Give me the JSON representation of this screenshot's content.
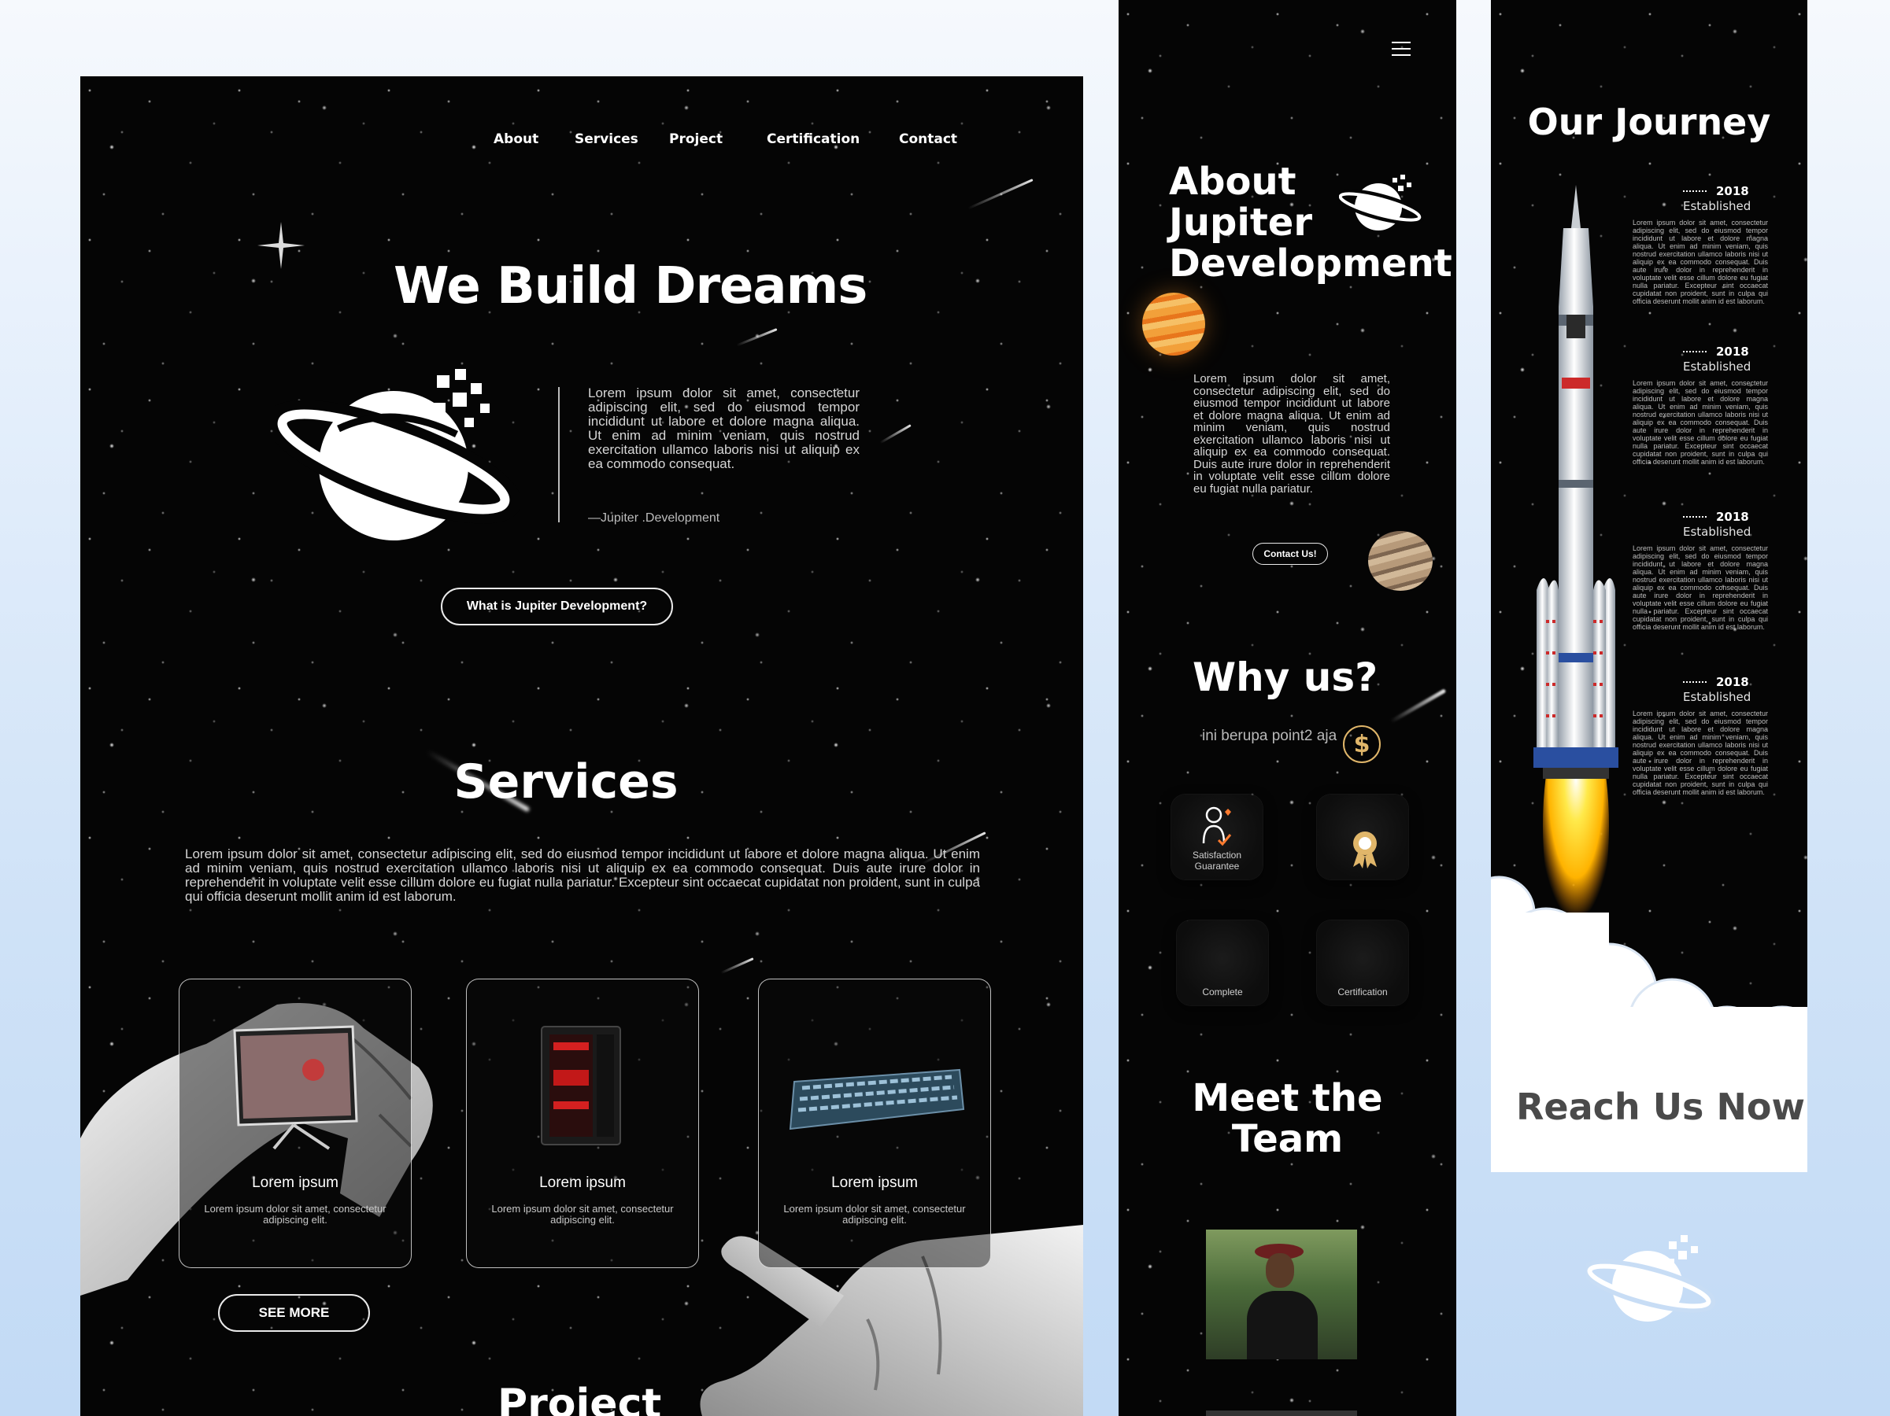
{
  "nav": {
    "links": [
      "About",
      "Services",
      "Project",
      "Certification",
      "Contact"
    ]
  },
  "hero": {
    "title": "We Build Dreams",
    "quote": "Lorem ipsum dolor sit amet, consectetur adipiscing elit, sed do eiusmod tempor incididunt ut labore et dolore magna aliqua. Ut enim ad minim veniam, quis nostrud exercitation ullamco laboris nisi ut aliquip ex ea commodo consequat.",
    "signature": "—Jupiter .Development",
    "cta_label": "What is Jupiter Development?"
  },
  "services": {
    "title": "Services",
    "description": "Lorem ipsum dolor sit amet, consectetur adipiscing elit, sed do eiusmod tempor incididunt ut labore et dolore magna aliqua. Ut enim ad minim veniam, quis nostrud exercitation ullamco laboris nisi ut aliquip ex ea commodo consequat. Duis aute irure dolor in reprehenderit in voluptate velit esse cillum dolore eu fugiat nulla pariatur. Excepteur sint occaecat cupidatat non proident, sunt in culpa qui officia deserunt mollit anim id est laborum.",
    "cards": [
      {
        "title": "Lorem ipsum",
        "desc": "Lorem ipsum dolor sit amet, consectetur adipiscing elit."
      },
      {
        "title": "Lorem ipsum",
        "desc": "Lorem ipsum dolor sit amet, consectetur adipiscing elit."
      },
      {
        "title": "Lorem ipsum",
        "desc": "Lorem ipsum dolor sit amet, consectetur adipiscing elit."
      }
    ],
    "see_more_label": "SEE MORE"
  },
  "project": {
    "title": "Project"
  },
  "mobile_about": {
    "menu_icon": "hamburger-icon",
    "title_line1": "About",
    "title_line2": "Jupiter",
    "title_line3": "Development",
    "body": "Lorem ipsum dolor sit amet, consectetur adipiscing elit, sed do eiusmod tempor incididunt ut labore et dolore magna aliqua. Ut enim ad minim veniam, quis nostrud exercitation ullamco laboris nisi ut aliquip ex ea commodo consequat. Duis aute irure dolor in reprehenderit in voluptate velit esse cillum dolore eu fugiat nulla pariatur.",
    "contact_label": "Contact Us!"
  },
  "why_us": {
    "title": "Why us?",
    "subtitle": "ini berupa point2 aja",
    "features": [
      {
        "label": "Satisfaction Guarantee",
        "icon": "satisfaction-icon"
      },
      {
        "label": "",
        "icon": "award-ribbon-icon"
      },
      {
        "label": "Complete",
        "icon": ""
      },
      {
        "label": "Certification",
        "icon": ""
      }
    ]
  },
  "team": {
    "title_line1": "Meet the",
    "title_line2": "Team"
  },
  "journey": {
    "title": "Our Journey",
    "items": [
      {
        "year": "2018",
        "label": "Established",
        "text": "Lorem ipsum dolor sit amet, consectetur adipiscing elit, sed do eiusmod tempor incididunt ut labore et dolore magna aliqua. Ut enim ad minim veniam, quis nostrud exercitation ullamco laboris nisi ut aliquip ex ea commodo consequat. Duis aute irure dolor in reprehenderit in voluptate velit esse cillum dolore eu fugiat nulla pariatur. Excepteur sint occaecat cupidatat non proident, sunt in culpa qui officia deserunt mollit anim id est laborum."
      },
      {
        "year": "2018",
        "label": "Established",
        "text": "Lorem ipsum dolor sit amet, consectetur adipiscing elit, sed do eiusmod tempor incididunt ut labore et dolore magna aliqua. Ut enim ad minim veniam, quis nostrud exercitation ullamco laboris nisi ut aliquip ex ea commodo consequat. Duis aute irure dolor in reprehenderit in voluptate velit esse cillum dolore eu fugiat nulla pariatur. Excepteur sint occaecat cupidatat non proident, sunt in culpa qui officia deserunt mollit anim id est laborum."
      },
      {
        "year": "2018",
        "label": "Established",
        "text": "Lorem ipsum dolor sit amet, consectetur adipiscing elit, sed do eiusmod tempor incididunt ut labore et dolore magna aliqua. Ut enim ad minim veniam, quis nostrud exercitation ullamco laboris nisi ut aliquip ex ea commodo consequat. Duis aute irure dolor in reprehenderit in voluptate velit esse cillum dolore eu fugiat nulla pariatur. Excepteur sint occaecat cupidatat non proident, sunt in culpa qui officia deserunt mollit anim id est laborum."
      },
      {
        "year": "2018",
        "label": "Established",
        "text": "Lorem ipsum dolor sit amet, consectetur adipiscing elit, sed do eiusmod tempor incididunt ut labore et dolore magna aliqua. Ut enim ad minim veniam, quis nostrud exercitation ullamco laboris nisi ut aliquip ex ea commodo consequat. Duis aute irure dolor in reprehenderit in voluptate velit esse cillum dolore eu fugiat nulla pariatur. Excepteur sint occaecat cupidatat non proident, sunt in culpa qui officia deserunt mollit anim id est laborum."
      }
    ],
    "reach_us": "Reach Us Now"
  },
  "colors": {
    "space_black": "#050505",
    "page_bg": "#cfe2f7",
    "accent_gold": "#e0b66a",
    "reach_us_text": "#4a4a4a"
  }
}
